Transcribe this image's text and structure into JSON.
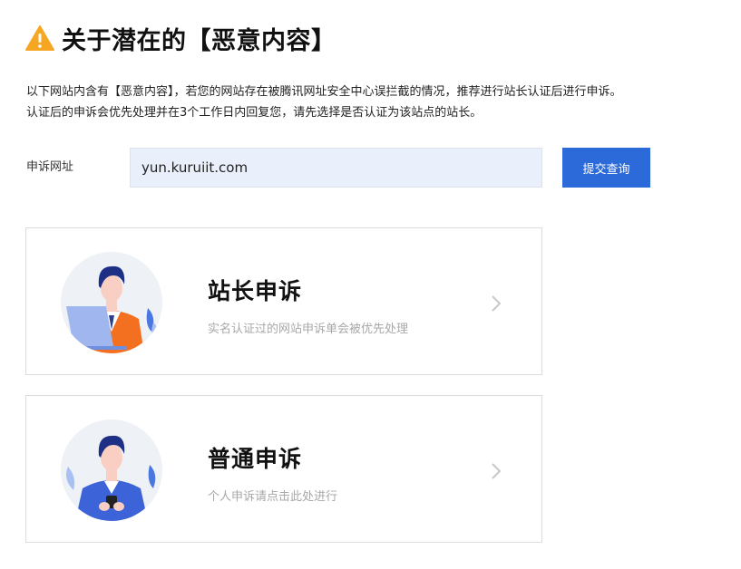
{
  "page": {
    "title": "关于潜在的【恶意内容】",
    "title_icon": "warning-triangle-icon"
  },
  "description": {
    "line1": "以下网站内含有【恶意内容】，若您的网站存在被腾讯网址安全中心误拦截的情况，推荐进行站长认证后进行申诉。",
    "line2": "认证后的申诉会优先处理并在3个工作日内回复您，请先选择是否认证为该站点的站长。"
  },
  "url_form": {
    "label": "申诉网址",
    "value": "yun.kuruiit.com",
    "submit_label": "提交查询"
  },
  "cards": [
    {
      "title": "站长申诉",
      "subtitle": "实名认证过的网站申诉单会被优先处理",
      "icon": "webmaster-avatar-icon"
    },
    {
      "title": "普通申诉",
      "subtitle": "个人申诉请点击此处进行",
      "icon": "user-avatar-icon"
    }
  ],
  "colors": {
    "accent": "#2b6ad8",
    "warning": "#f5a623",
    "input_bg": "#e9f0fb",
    "subtext": "#a8a8a8"
  }
}
